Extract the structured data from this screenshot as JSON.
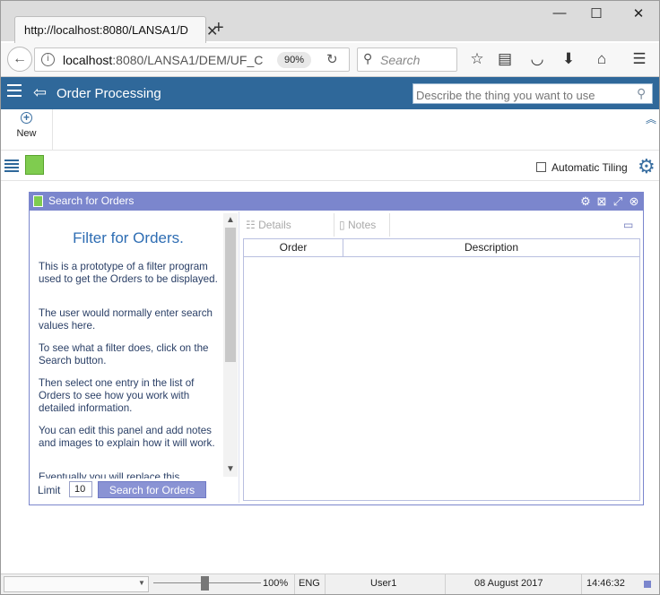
{
  "browser": {
    "tab_title": "http://localhost:8080/LANSA1/D",
    "url_host": "localhost",
    "url_path": ":8080/LANSA1/DEM/UF_C",
    "zoom": "90%",
    "search_placeholder": "Search",
    "window_controls": {
      "minimize": "—",
      "maximize": "☐",
      "close": "✕"
    }
  },
  "app": {
    "title": "Order Processing",
    "search_placeholder": "Describe the thing you want to use",
    "accent_color": "#2f689a"
  },
  "commands": {
    "new_label": "New"
  },
  "workbar": {
    "auto_tiling_label": "Automatic Tiling",
    "auto_tiling_checked": false
  },
  "panel": {
    "title": "Search for Orders",
    "header_color": "#7b86cd",
    "filter_heading": "Filter for Orders.",
    "paragraphs": [
      "This is a prototype of a filter program used to get the Orders to be displayed.",
      "The user would normally enter search values here.",
      "To see what a filter does, click on the Search button.",
      "Then select one entry in the list of Orders to see how you work with detailed information.",
      "You can edit this panel and add notes and images to explain how it will work.",
      "Eventually you will replace this"
    ],
    "limit_label": "Limit",
    "limit_value": "10",
    "search_button": "Search for Orders",
    "toolbar": {
      "details_label": "Details",
      "notes_label": "Notes"
    },
    "grid": {
      "columns": [
        "Order",
        "Description"
      ],
      "rows": []
    }
  },
  "status": {
    "zoom": "100%",
    "language": "ENG",
    "user": "User1",
    "date": "08 August 2017",
    "time": "14:46:32"
  }
}
